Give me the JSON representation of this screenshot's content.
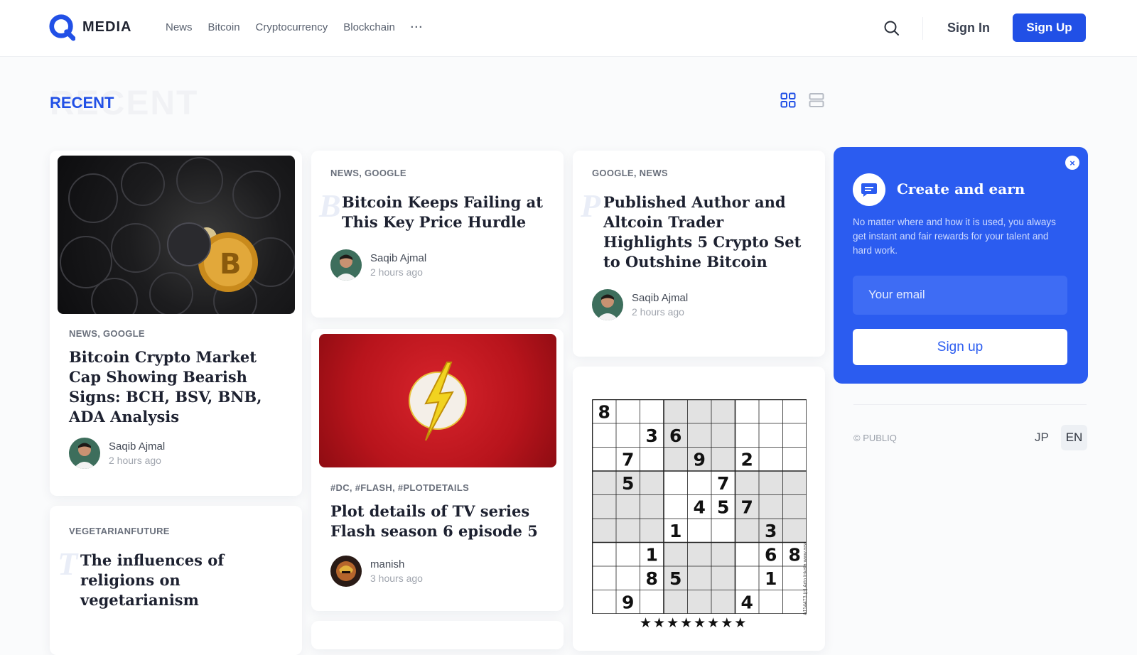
{
  "header": {
    "logo_text": "MEDIA",
    "nav": [
      "News",
      "Bitcoin",
      "Cryptocurrency",
      "Blockchain"
    ],
    "more": "···",
    "sign_in": "Sign In",
    "sign_up": "Sign Up"
  },
  "section": {
    "title": "RECENT",
    "ghost": "RECENT"
  },
  "cards": {
    "bitcoin_cap": {
      "tags": "NEWS, GOOGLE",
      "title": "Bitcoin Crypto Market Cap Showing Bearish Signs: BCH, BSV, BNB, ADA Analysis",
      "author": "Saqib Ajmal",
      "time": "2 hours ago"
    },
    "hurdle": {
      "tags": "NEWS, GOOGLE",
      "ghost": "B",
      "title": "Bitcoin Keeps Failing at This Key Price Hurdle",
      "author": "Saqib Ajmal",
      "time": "2 hours ago"
    },
    "altcoin": {
      "tags": "GOOGLE, NEWS",
      "ghost": "P",
      "title": "Published Author and Altcoin Trader Highlights 5 Crypto Set to Outshine Bitcoin",
      "author": "Saqib Ajmal",
      "time": "2 hours ago"
    },
    "flash": {
      "tags": "#DC, #FLASH, #PLOTDETAILS",
      "title": "Plot details of TV series Flash season 6 episode 5",
      "author": "manish",
      "time": "3 hours ago"
    },
    "vegetarian": {
      "tags": "VEGETARIANFUTURE",
      "ghost": "T",
      "title": "The influences of religions on vegetarianism"
    }
  },
  "promo": {
    "close": "×",
    "title": "Create and earn",
    "text": "No matter where and how it is used, you always get instant and fair rewards for your talent and hard work.",
    "email_placeholder": "Your email",
    "button": "Sign up"
  },
  "footer": {
    "copyright": "© PUBLIQ",
    "lang_jp": "JP",
    "lang_en": "EN"
  },
  "sudoku": {
    "grid": [
      [
        "8",
        "",
        "",
        "",
        "",
        "",
        "",
        "",
        ""
      ],
      [
        "",
        "",
        "3",
        "6",
        "",
        "",
        "",
        "",
        ""
      ],
      [
        "",
        "7",
        "",
        "",
        "9",
        "",
        "2",
        "",
        ""
      ],
      [
        "",
        "5",
        "",
        "",
        "",
        "7",
        "",
        "",
        ""
      ],
      [
        "",
        "",
        "",
        "",
        "4",
        "5",
        "7",
        "",
        ""
      ],
      [
        "",
        "",
        "",
        "1",
        "",
        "",
        "",
        "3",
        ""
      ],
      [
        "",
        "",
        "1",
        "",
        "",
        "",
        "",
        "6",
        "8"
      ],
      [
        "",
        "",
        "8",
        "5",
        "",
        "",
        "",
        "1",
        ""
      ],
      [
        "",
        "9",
        "",
        "",
        "",
        "",
        "4",
        "",
        ""
      ]
    ],
    "stars": "★★★★★★★★",
    "side_text": "A114473 (c) Arto Inkala www.aisudoku.com"
  },
  "colors": {
    "accent": "#2150e6",
    "promo_bg": "#2b5cf0"
  }
}
